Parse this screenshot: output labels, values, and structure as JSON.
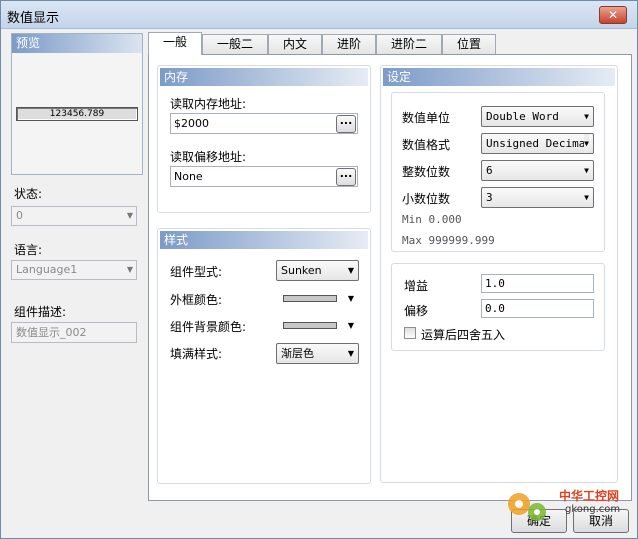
{
  "window": {
    "title": "数值显示",
    "close": "✕"
  },
  "left": {
    "preview_label": "预览",
    "preview_value": "123456.789",
    "state_label": "状态:",
    "state_value": "0",
    "lang_label": "语言:",
    "lang_value": "Language1",
    "desc_label": "组件描述:",
    "desc_value": "数值显示_002"
  },
  "tabs": [
    "一般",
    "一般二",
    "内文",
    "进阶",
    "进阶二",
    "位置"
  ],
  "memory": {
    "title": "内存",
    "read_addr_label": "读取内存地址:",
    "read_addr_value": "$2000",
    "offset_label": "读取偏移地址:",
    "offset_value": "None",
    "browse": "..."
  },
  "style": {
    "title": "样式",
    "type_label": "组件型式:",
    "type_value": "Sunken",
    "border_label": "外框颜色:",
    "bg_label": "组件背景颜色:",
    "fill_label": "填满样式:",
    "fill_value": "渐层色"
  },
  "settings": {
    "title": "设定",
    "unit_label": "数值单位",
    "unit_value": "Double Word",
    "format_label": "数值格式",
    "format_value": "Unsigned Decima",
    "int_label": "整数位数",
    "int_value": "6",
    "dec_label": "小数位数",
    "dec_value": "3",
    "min_text": "Min 0.000",
    "max_text": "Max 999999.999"
  },
  "gain": {
    "gain_label": "增益",
    "gain_value": "1.0",
    "offset_label": "偏移",
    "offset_value": "0.0",
    "round_label": "运算后四舍五入"
  },
  "buttons": {
    "ok": "确定",
    "cancel": "取消"
  },
  "watermark": {
    "text": "中华工控网",
    "url": "gkong.com"
  },
  "colors": {
    "header_blue": "#7c9bc8",
    "swatch_gray": "#c8c8c8"
  }
}
